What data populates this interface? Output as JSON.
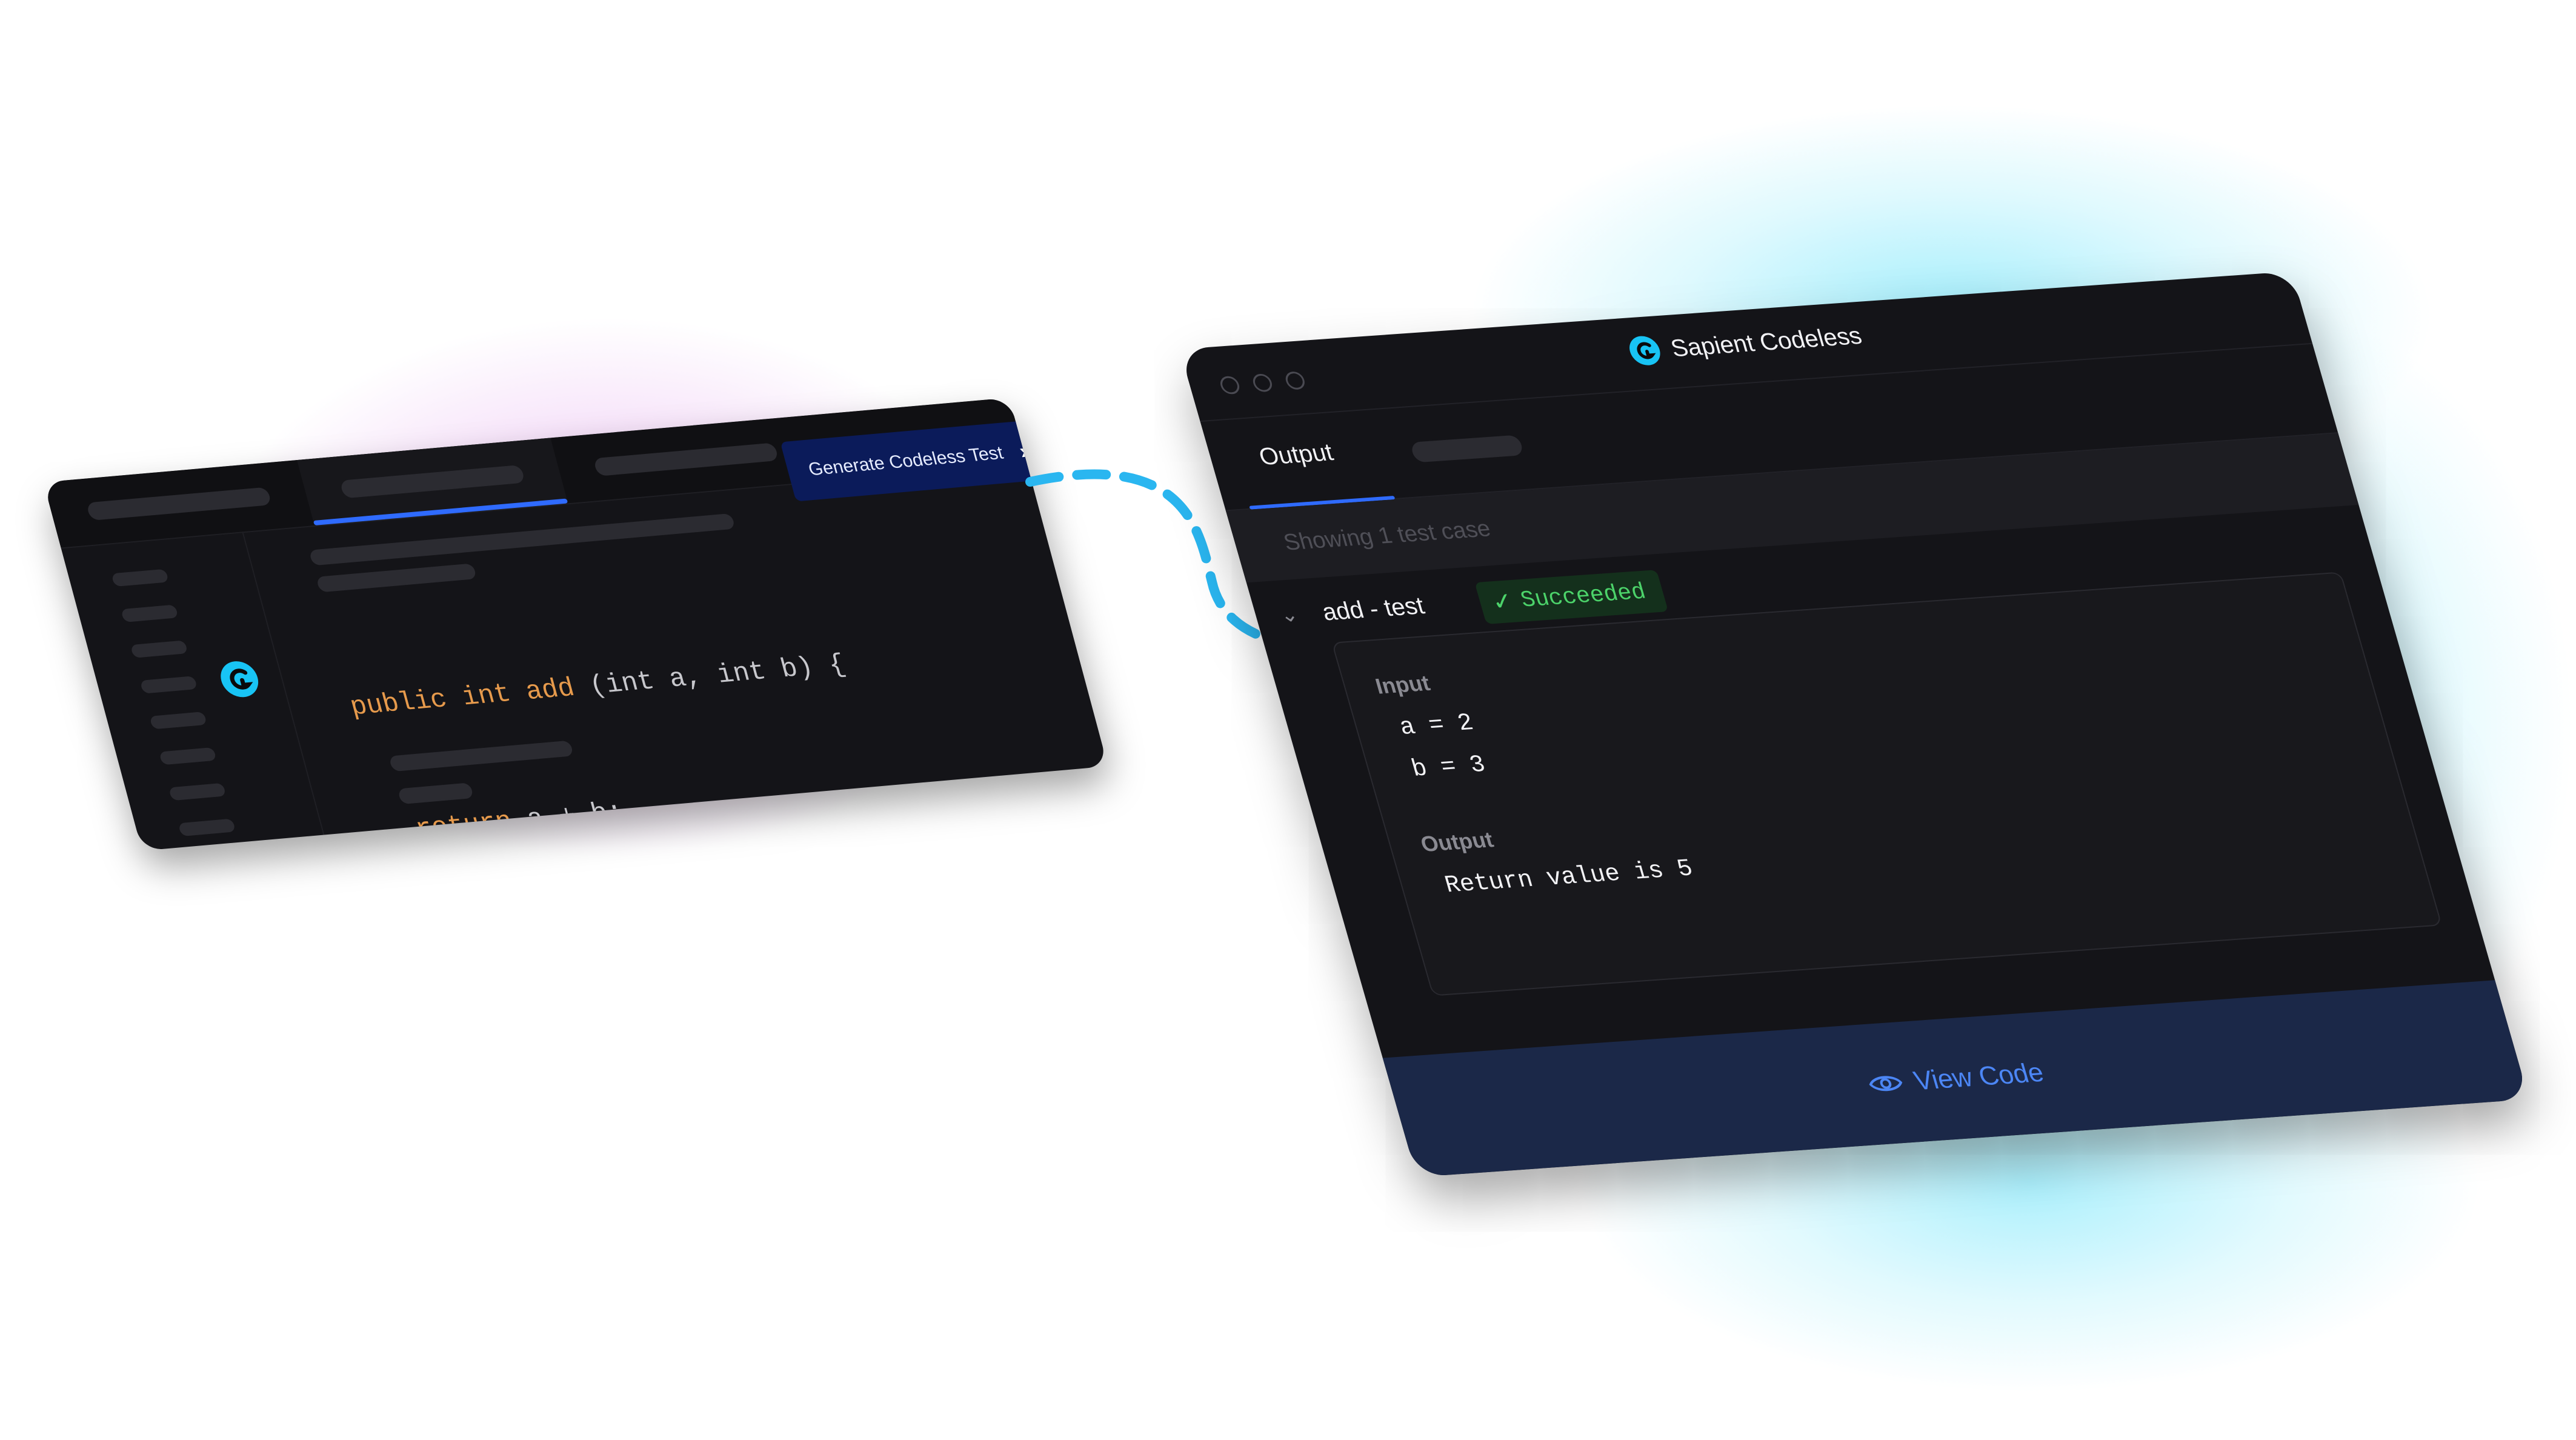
{
  "editor": {
    "code_lines": [
      [
        {
          "t": "public int add ",
          "kw": true
        },
        {
          "t": "(int a, int b) {",
          "kw": false
        }
      ],
      [
        {
          "t": "  return ",
          "kw": true
        },
        {
          "t": "a + b;",
          "kw": false
        }
      ],
      [
        {
          "t": "  }",
          "kw": false
        }
      ]
    ],
    "generate_button_label": "Generate Codeless Test",
    "generate_button_icon": "chevron-right-icon",
    "logo_icon": "sapient-logo-icon"
  },
  "app": {
    "title": "Sapient Codeless",
    "logo_icon": "sapient-logo-icon",
    "tabs": {
      "output_label": "Output"
    },
    "showing_text": "Showing 1 test case",
    "test_case": {
      "name": "add - test",
      "status": "Succeeded",
      "status_icon": "check-icon",
      "input_label": "Input",
      "input_lines": [
        "a = 2",
        "b = 3"
      ],
      "output_label": "Output",
      "output_text": "Return value is 5"
    },
    "view_code_label": "View Code",
    "view_code_icon": "eye-icon"
  },
  "colors": {
    "accent_blue": "#2f6bff",
    "success_green": "#4cd36a",
    "keyword_orange": "#e69a4c",
    "glow_cyan": "#5ae1fa",
    "glow_pink": "#d678e6"
  }
}
